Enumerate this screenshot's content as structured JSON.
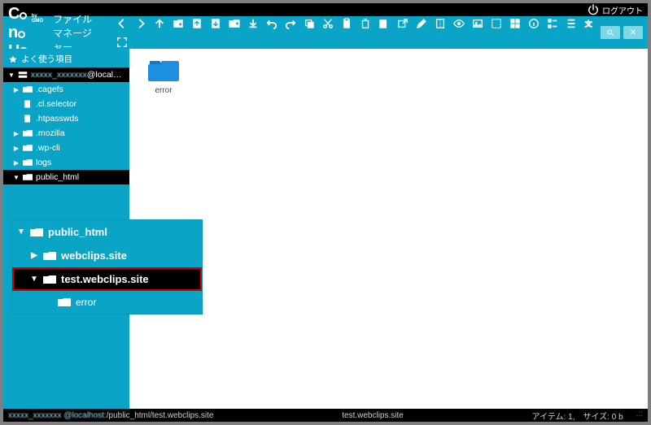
{
  "titlebar": {
    "logout": "ログアウト"
  },
  "header": {
    "logo_main": "ConoHa",
    "logo_sub": "by GMO",
    "app_name": "ファイルマネージャー"
  },
  "toolbar_icons": [
    "back",
    "forward",
    "up",
    "new-file",
    "upload",
    "download",
    "new-folder",
    "download-arrow",
    "undo",
    "redo",
    "copy",
    "cut",
    "paste",
    "delete",
    "rename",
    "open-external",
    "edit",
    "compress",
    "preview",
    "image",
    "select-all",
    "grid",
    "info",
    "list",
    "thumbs",
    "language",
    "settings"
  ],
  "sidebar": {
    "favorites_label": "よく使う項目",
    "host_label_blurred": "xxxxx_xxxxxxx",
    "host_label_suffix": "@localhost",
    "items": [
      {
        "label": ".cagefs",
        "depth": 1,
        "arrow": "▶",
        "type": "folder"
      },
      {
        "label": ".cl.selector",
        "depth": 1,
        "arrow": "",
        "type": "file"
      },
      {
        "label": ".htpasswds",
        "depth": 1,
        "arrow": "",
        "type": "file"
      },
      {
        "label": ".mozilla",
        "depth": 1,
        "arrow": "▶",
        "type": "folder"
      },
      {
        "label": ".wp-cli",
        "depth": 1,
        "arrow": "▶",
        "type": "folder"
      },
      {
        "label": "logs",
        "depth": 1,
        "arrow": "▶",
        "type": "folder"
      },
      {
        "label": "public_html",
        "depth": 1,
        "arrow": "▼",
        "type": "folder",
        "selected": true
      }
    ]
  },
  "popout": {
    "items": [
      {
        "label": "public_html",
        "depth": 0,
        "arrow": "▼",
        "hl": false
      },
      {
        "label": "webclips.site",
        "depth": 1,
        "arrow": "▶",
        "hl": false
      },
      {
        "label": "test.webclips.site",
        "depth": 1,
        "arrow": "▼",
        "hl": true
      },
      {
        "label": "error",
        "depth": 2,
        "arrow": "",
        "hl": false
      }
    ]
  },
  "main": {
    "folder_label": "error"
  },
  "status": {
    "path_blurred": "xxxxx_xxxxxxx @localhost:",
    "path_tail": "/public_html/test.webclips.site",
    "center": "test.webclips.site",
    "items": "アイテム: 1,",
    "size": "サイズ: 0 b"
  }
}
